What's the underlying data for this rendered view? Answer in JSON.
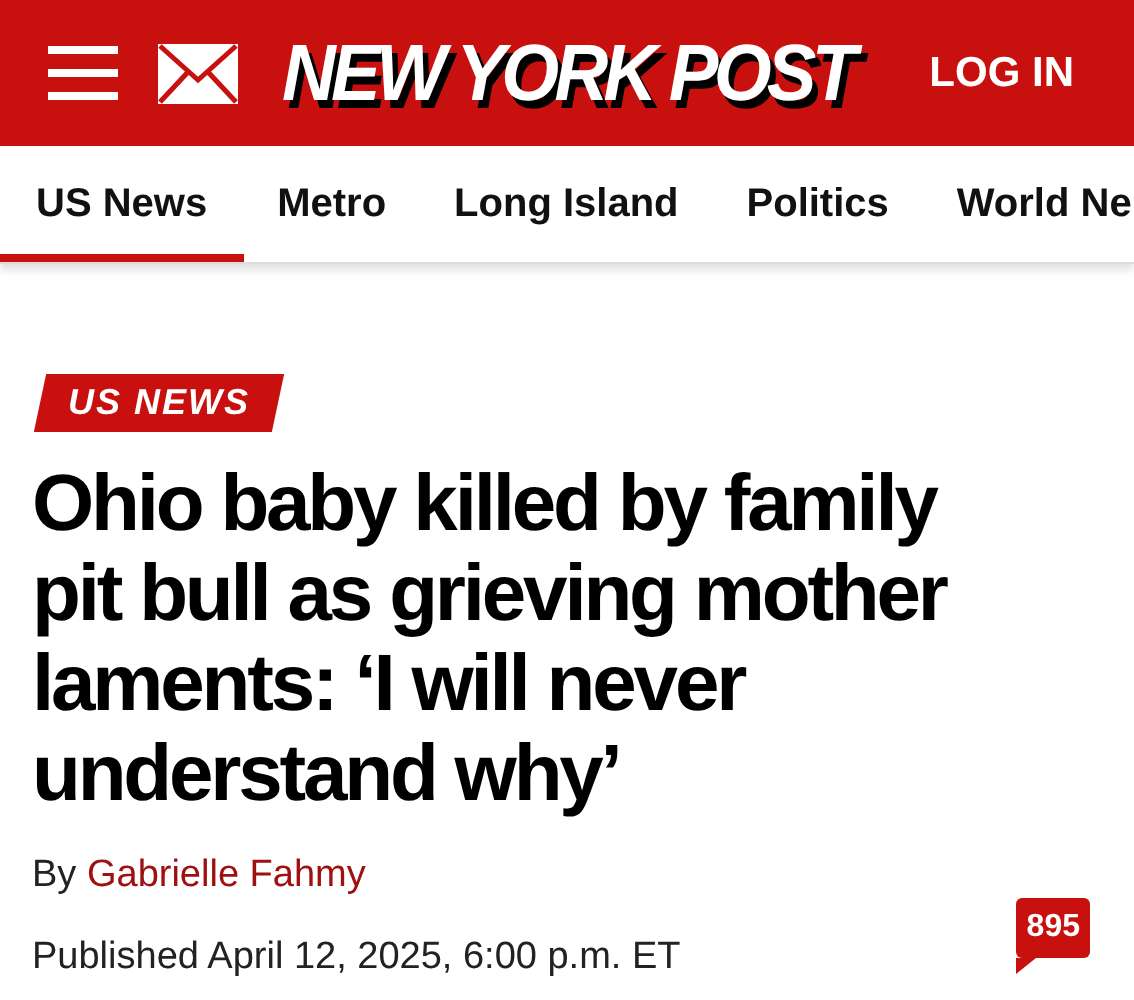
{
  "header": {
    "logo": "NEW YORK POST",
    "login": "LOG IN"
  },
  "nav": [
    {
      "label": "US News",
      "selected": true
    },
    {
      "label": "Metro",
      "selected": false
    },
    {
      "label": "Long Island",
      "selected": false
    },
    {
      "label": "Politics",
      "selected": false
    },
    {
      "label": "World Ne",
      "selected": false
    }
  ],
  "article": {
    "section_tag": "US NEWS",
    "headline": "Ohio baby killed by family pit bull as grieving mother laments: ‘I will never understand why’",
    "byline_prefix": "By",
    "author": "Gabrielle Fahmy",
    "published": "Published April 12, 2025, 6:00 p.m. ET",
    "comment_count": "895"
  }
}
